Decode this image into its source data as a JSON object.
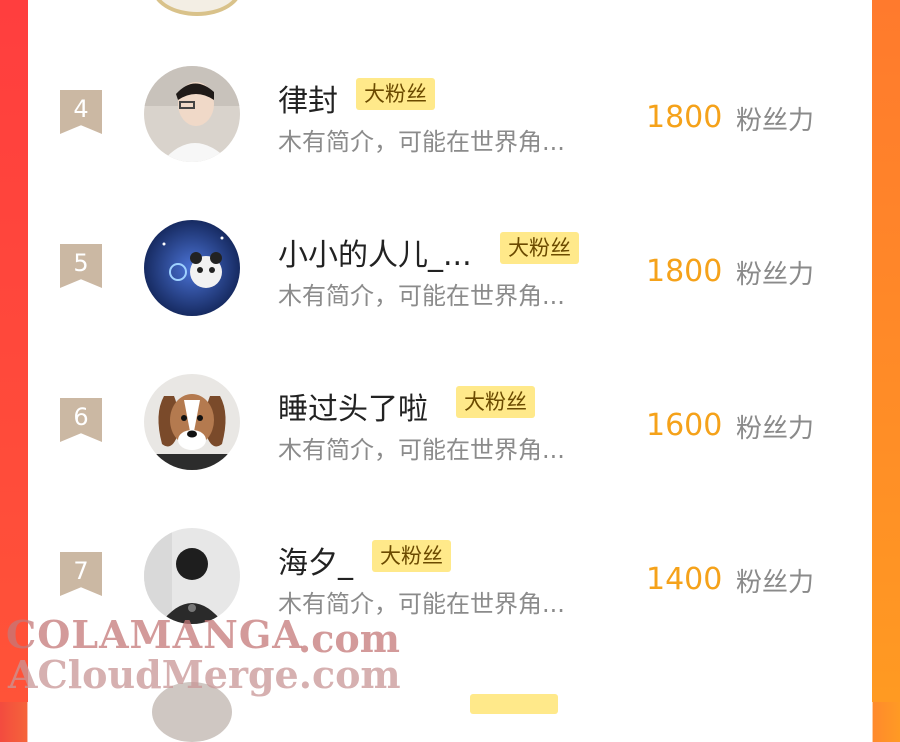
{
  "list": [
    {
      "rank": "4",
      "name": "律封",
      "badge": "大粉丝",
      "bio": "木有简介，可能在世界角...",
      "score": "1800",
      "unit": "粉丝力"
    },
    {
      "rank": "5",
      "name": "小小的人儿_...",
      "badge": "大粉丝",
      "bio": "木有简介，可能在世界角...",
      "score": "1800",
      "unit": "粉丝力"
    },
    {
      "rank": "6",
      "name": "睡过头了啦",
      "badge": "大粉丝",
      "bio": "木有简介，可能在世界角...",
      "score": "1600",
      "unit": "粉丝力"
    },
    {
      "rank": "7",
      "name": "海夕_",
      "badge": "大粉丝",
      "bio": "木有简介，可能在世界角...",
      "score": "1400",
      "unit": "粉丝力"
    }
  ],
  "watermark": {
    "line1": "COLAMANGA",
    "line1_suffix": ".com",
    "line2": "ACloudMerge.com"
  }
}
